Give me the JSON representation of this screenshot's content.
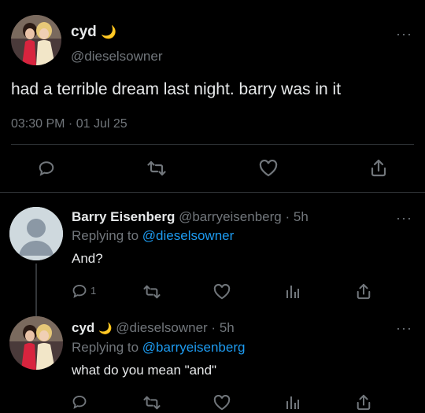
{
  "main_tweet": {
    "display_name": "cyd",
    "moon_emoji": "🌙",
    "handle": "@dieselsowner",
    "text": "had a terrible dream last night. barry was in it",
    "timestamp": "03:30 PM · 01 Jul 25",
    "more_label": "···"
  },
  "reply_1": {
    "display_name": "Barry Eisenberg",
    "handle": "@barryeisenberg",
    "separator": "·",
    "age": "5h",
    "replying_prefix": "Replying to",
    "replying_to": "@dieselsowner",
    "text": "And?",
    "reply_count": "1",
    "more_label": "···"
  },
  "reply_2": {
    "display_name": "cyd",
    "moon_emoji": "🌙",
    "handle": "@dieselsowner",
    "separator": "·",
    "age": "5h",
    "replying_prefix": "Replying to",
    "replying_to": "@barryeisenberg",
    "text": "what do you mean \"and\"",
    "more_label": "···"
  },
  "colors": {
    "background": "#000000",
    "text": "#e7e9ea",
    "muted": "#71767b",
    "link": "#1d9bf0",
    "divider": "#2f3336"
  }
}
